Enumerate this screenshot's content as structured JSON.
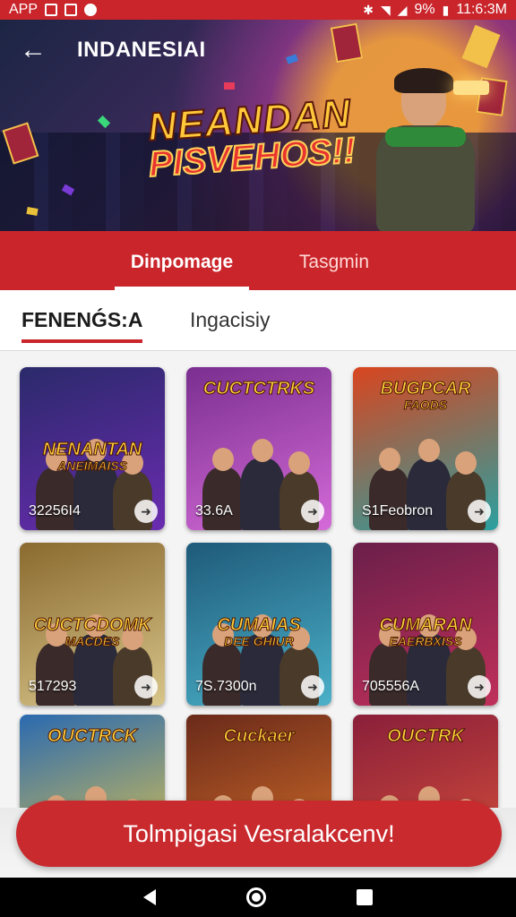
{
  "status_bar": {
    "app_label": "APP",
    "battery_text": "9%",
    "time": "11:6:3M"
  },
  "header": {
    "back_icon": "arrow-left-icon",
    "title": "INDANESIAI",
    "banner_line1": "NEANDAN",
    "banner_line2": "PISVEHOS!!"
  },
  "tabs": [
    {
      "label": "Dinpomage",
      "active": true
    },
    {
      "label": "Tasgmin",
      "active": false
    }
  ],
  "subtabs": [
    {
      "label": "FENENǴS:A",
      "active": true
    },
    {
      "label": "Ingacisiy",
      "active": false
    }
  ],
  "tiles": [
    {
      "title": "NENANTAN",
      "subtitle": "ANEIMAISS",
      "count": "32256I4",
      "colors": [
        "#2b2a6b",
        "#6a2bb0"
      ]
    },
    {
      "title": "CUCTCTRKS",
      "subtitle": "",
      "count": "33.6A",
      "colors": [
        "#7a2f8f",
        "#d46ad8"
      ]
    },
    {
      "title": "BUGPCAR",
      "subtitle": "FAODS",
      "count": "S1Feobron",
      "colors": [
        "#d9451f",
        "#2aa0a0"
      ]
    },
    {
      "title": "CUCTCDOMK",
      "subtitle": "MACDES",
      "count": "517293",
      "colors": [
        "#8a6a2f",
        "#d8c58a"
      ]
    },
    {
      "title": "CUMAIAS",
      "subtitle": "DEE GHIUR",
      "count": "7S.7300n",
      "colors": [
        "#1f5a7a",
        "#4ab0c8"
      ]
    },
    {
      "title": "CUMARAN",
      "subtitle": "EAERBXISS",
      "count": "705556A",
      "colors": [
        "#6a1f4a",
        "#c0305a"
      ]
    },
    {
      "title": "OUCTRCK",
      "subtitle": "",
      "count": "",
      "colors": [
        "#2a6ab0",
        "#e8c84a"
      ]
    },
    {
      "title": "Cuckaer",
      "subtitle": "",
      "count": "",
      "colors": [
        "#6a2a1a",
        "#d8702a"
      ]
    },
    {
      "title": "OUCTRK",
      "subtitle": "",
      "count": "",
      "colors": [
        "#8a1f3a",
        "#d8503a"
      ]
    }
  ],
  "cta": {
    "label": "Tolmpigasi Vesralakcenv!"
  },
  "nav": {
    "back_icon": "nav-back-icon",
    "home_icon": "nav-home-icon",
    "recent_icon": "nav-recent-icon"
  },
  "colors": {
    "brand_red": "#c9252b",
    "cta_red": "#c92a2e"
  }
}
